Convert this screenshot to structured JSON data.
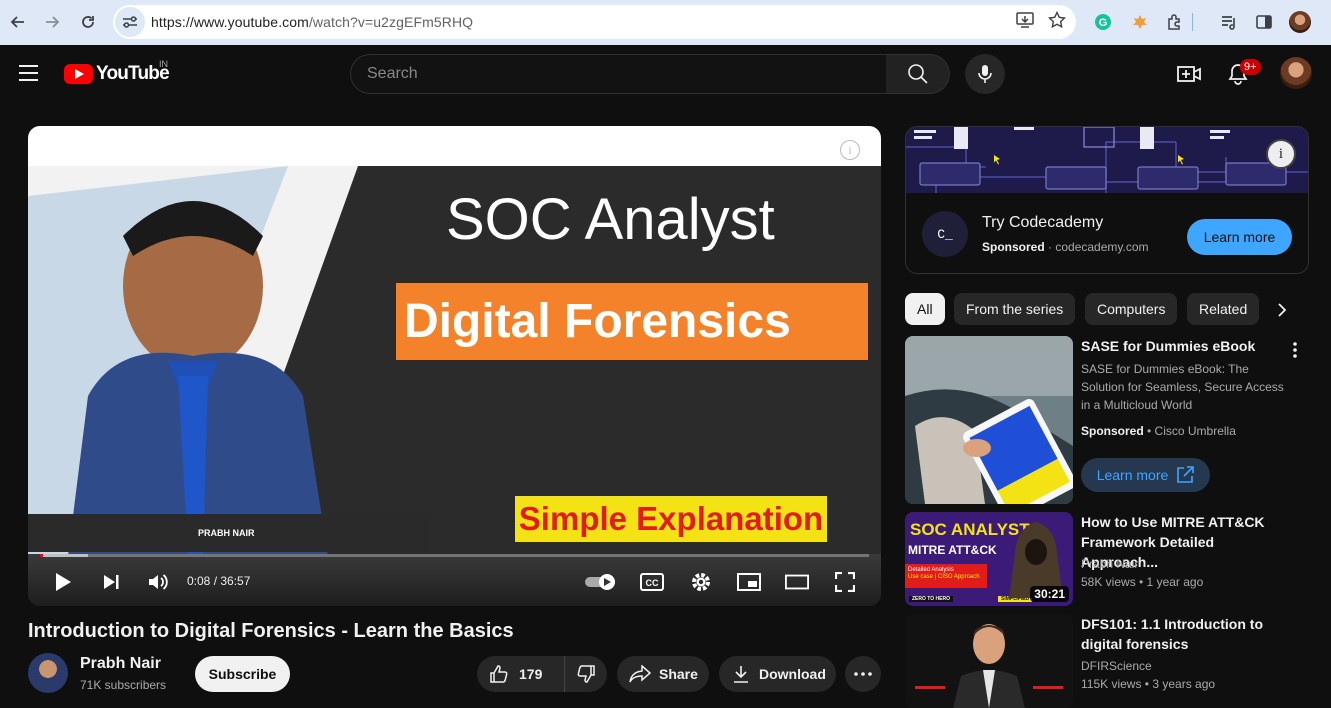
{
  "browser": {
    "url_host": "https://www.youtube.com",
    "url_path": "/watch?v=u2zgEFm5RHQ"
  },
  "header": {
    "logo_text": "YouTube",
    "country": "IN",
    "search_placeholder": "Search",
    "notification_count": "9+"
  },
  "player": {
    "thumb_title": "SOC Analyst",
    "thumb_banner": "Digital Forensics",
    "thumb_tag": "Simple Explanation",
    "thumb_name": "PRABH NAIR",
    "time": "0:08 / 36:57",
    "progress_fraction": 0.0036,
    "buffer_fraction": 0.058
  },
  "video": {
    "title": "Introduction to Digital Forensics - Learn the Basics",
    "channel": "Prabh Nair",
    "subscribers": "71K subscribers",
    "subscribe_label": "Subscribe",
    "likes": "179",
    "share_label": "Share",
    "download_label": "Download"
  },
  "ad": {
    "title": "Try Codecademy",
    "sponsored": "Sponsored",
    "domain": "codecademy.com",
    "cta": "Learn more",
    "logo_glyph": "C_"
  },
  "chips": [
    "All",
    "From the series",
    "Computers",
    "Related"
  ],
  "recommendations": [
    {
      "title": "SASE for Dummies eBook",
      "description": "SASE for Dummies eBook: The Solution for Seamless, Secure Access in a Multicloud World",
      "sponsored": "Sponsored",
      "advertiser": "Cisco Umbrella",
      "cta": "Learn more"
    },
    {
      "title": "How to Use MITRE ATT&CK Framework Detailed Approach...",
      "channel": "Prabh Nair",
      "meta": "58K views • 1 year ago",
      "duration": "30:21",
      "thumb_line1": "SOC ANALYST",
      "thumb_line2": "MITRE ATT&CK",
      "thumb_line3": "Detailed Analysis",
      "thumb_line4": "Use case | CISO Approach",
      "thumb_line5": "ZERO TO HERO",
      "thumb_line6": "SIMPLIFIED"
    },
    {
      "title": "DFS101: 1.1 Introduction to digital forensics",
      "channel": "DFIRScience",
      "meta": "115K views • 3 years ago"
    }
  ],
  "colors": {
    "background": "#0f0f0f",
    "accent_blue": "#3ea6ff",
    "brand_red": "#ff0000",
    "banner_orange": "#f4822a",
    "banner_yellow": "#f4e314"
  }
}
